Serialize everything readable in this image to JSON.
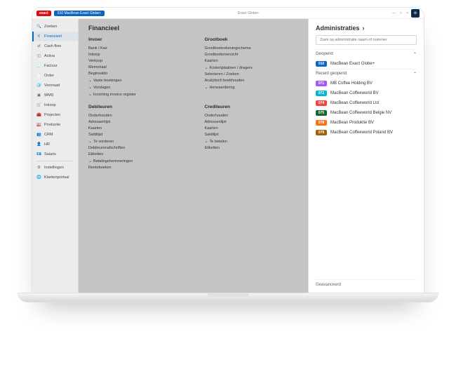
{
  "titlebar": {
    "logo": "exact",
    "admin_tag": "010  MacBean Exact Globe+",
    "product": "Exact Globe+",
    "minimize": "—",
    "maximize": "□",
    "close": "×",
    "gear": "⚙"
  },
  "sidebar": [
    {
      "icon": "🔍",
      "label": "Zoeken"
    },
    {
      "icon": "€",
      "label": "Financieel",
      "active": true
    },
    {
      "icon": "⇄",
      "label": "Cash flow"
    },
    {
      "icon": "◫",
      "label": "Activa"
    },
    {
      "icon": "🧾",
      "label": "Factuur"
    },
    {
      "icon": "📄",
      "label": "Order"
    },
    {
      "icon": "🧊",
      "label": "Voorraad"
    },
    {
      "icon": "▣",
      "label": "WMS"
    },
    {
      "icon": "🛒",
      "label": "Inkoop"
    },
    {
      "icon": "🧰",
      "label": "Projecten"
    },
    {
      "icon": "🏭",
      "label": "Productie"
    },
    {
      "icon": "👥",
      "label": "CRM"
    },
    {
      "icon": "👤",
      "label": "HR"
    },
    {
      "icon": "💶",
      "label": "Salaris"
    }
  ],
  "sidebar_bottom": [
    {
      "icon": "⚙",
      "label": "Instellingen"
    },
    {
      "icon": "🌐",
      "label": "Klantenportaal"
    }
  ],
  "main_title": "Financieel",
  "columns": [
    {
      "heading": "Invoer",
      "items": [
        {
          "t": "Bank / Kas"
        },
        {
          "t": "Inkoop"
        },
        {
          "t": "Verkoop"
        },
        {
          "t": "Memoriaal"
        },
        {
          "t": "Beginsaldo"
        },
        {
          "t": "Vaste boekingen",
          "exp": true
        },
        {
          "t": "Verslagen",
          "exp": true
        },
        {
          "t": "Incoming invoice register",
          "exp": true
        }
      ]
    },
    {
      "heading": "Grootboek",
      "items": [
        {
          "t": "Grootboekrekeningschema"
        },
        {
          "t": "Grootboekoverzicht"
        },
        {
          "t": "Kaarten"
        },
        {
          "t": "Kostenplaatsen / dragers",
          "exp": true
        },
        {
          "t": "Selecteren / Zoeken"
        },
        {
          "t": "Analytisch boekhouden"
        },
        {
          "t": "Herwaardering",
          "exp": true
        }
      ]
    },
    {
      "heading": "Debiteuren",
      "items": [
        {
          "t": "Onderhouden"
        },
        {
          "t": "Adressenlijst"
        },
        {
          "t": "Kaarten"
        },
        {
          "t": "Saldilijst"
        },
        {
          "t": "Te vorderen",
          "exp": true
        },
        {
          "t": "Debiteurenafschriften"
        },
        {
          "t": "Etiketten"
        },
        {
          "t": "Betalingsherinneringen",
          "exp": true
        },
        {
          "t": "Renteboeken"
        }
      ]
    },
    {
      "heading": "Crediteuren",
      "items": [
        {
          "t": "Onderhouden"
        },
        {
          "t": "Adressenlijst"
        },
        {
          "t": "Kaarten"
        },
        {
          "t": "Saldilijst"
        },
        {
          "t": "Te betalen",
          "exp": true
        },
        {
          "t": "Etiketten"
        }
      ]
    }
  ],
  "panel": {
    "title": "Administraties",
    "title_icon": "›",
    "search_placeholder": "Zoek op administratie naam of nummer",
    "sections": [
      {
        "name": "Geopend",
        "caret": "⌃",
        "rows": [
          {
            "code": "010",
            "bg": "#0a66c2",
            "label": "MacBean Exact Globe+"
          }
        ]
      },
      {
        "name": "Recent geopend",
        "caret": "⌃",
        "rows": [
          {
            "code": "071",
            "bg": "#a855f7",
            "label": "MB Coffee Holding BV"
          },
          {
            "code": "072",
            "bg": "#06b6d4",
            "label": "MacBean Coffeeworld BV"
          },
          {
            "code": "074",
            "bg": "#ef4444",
            "label": "MacBean Coffeeworld Ltd"
          },
          {
            "code": "075",
            "bg": "#166534",
            "label": "MacBean Coffeeworld Belgie NV"
          },
          {
            "code": "078",
            "bg": "#f97316",
            "label": "MacBean Produktie BV"
          },
          {
            "code": "079",
            "bg": "#a16207",
            "label": "MacBean Coffeeworld Poland BV"
          }
        ]
      }
    ],
    "footer": "Geavanceerd"
  }
}
